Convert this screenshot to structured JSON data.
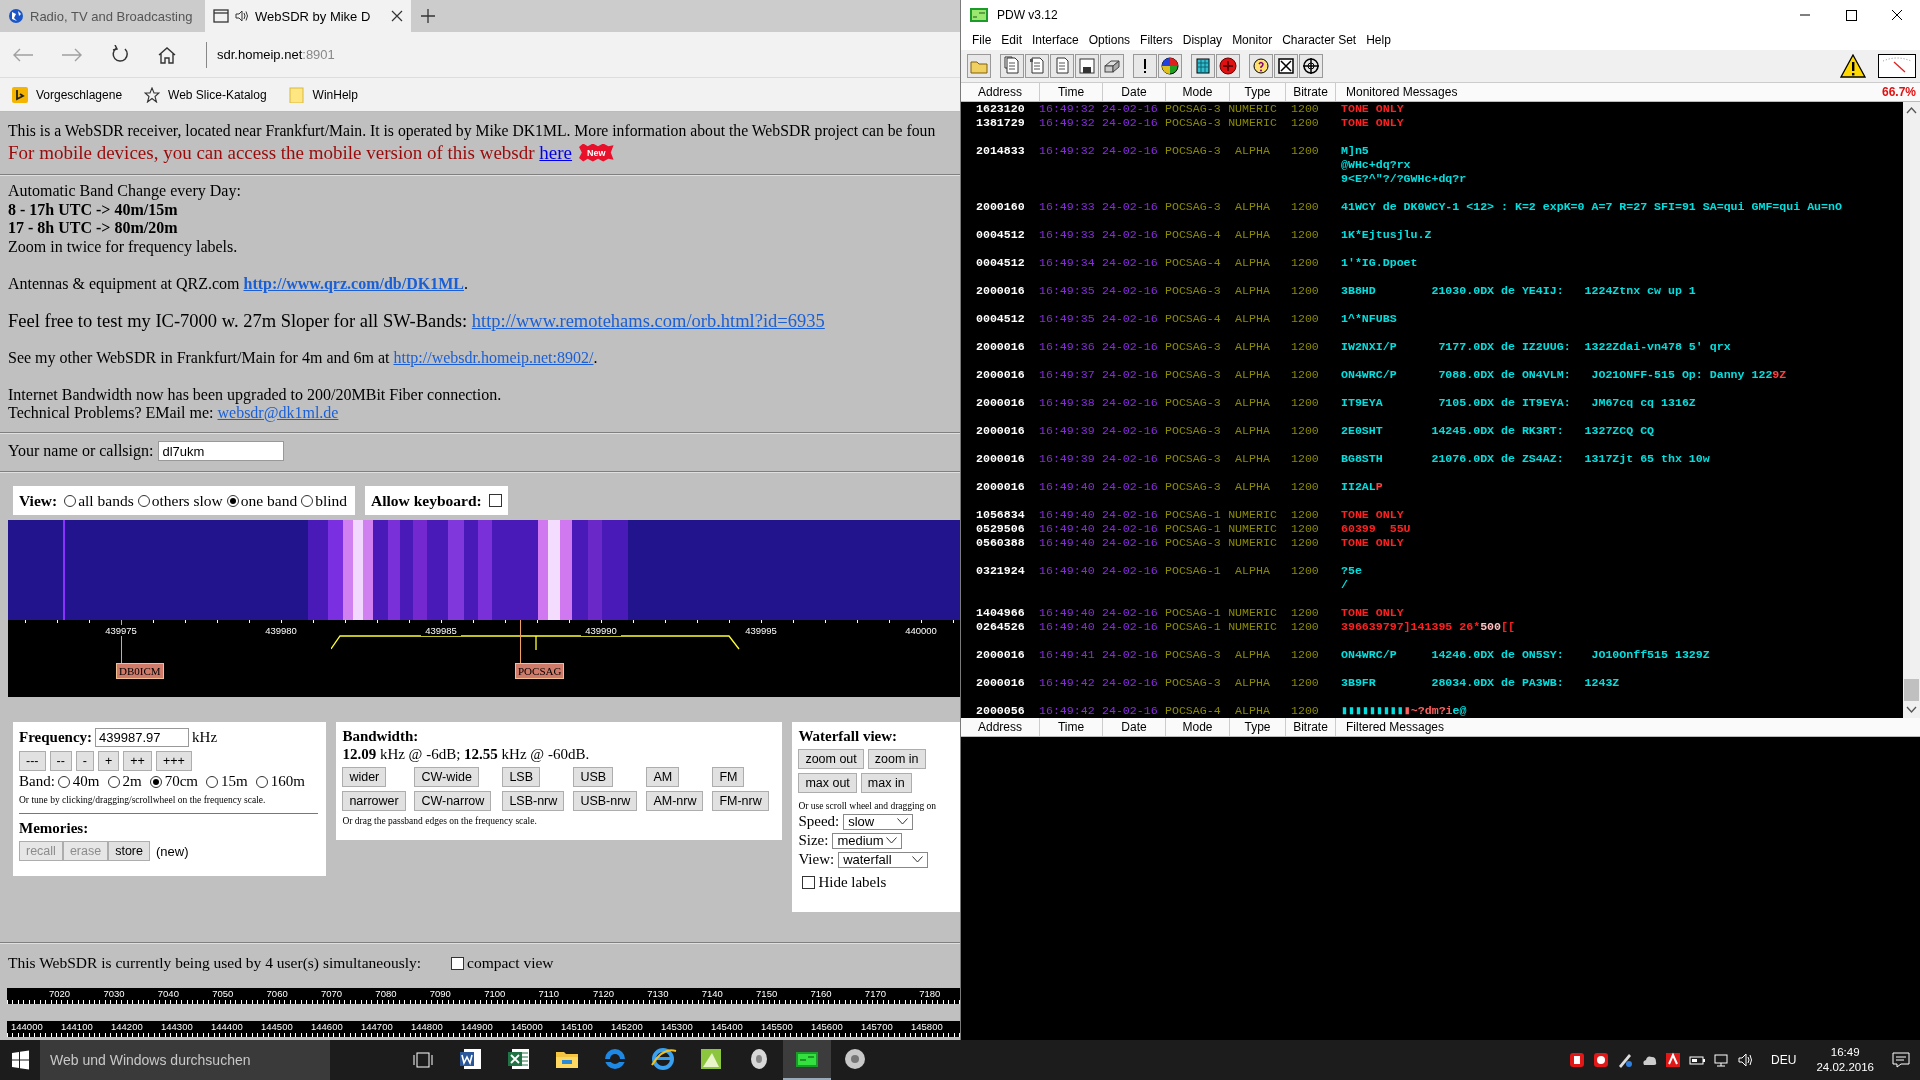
{
  "browser": {
    "tabs": [
      {
        "title": "Radio, TV and Broadcasting",
        "selected": false,
        "kind": "site"
      },
      {
        "title": "WebSDR by Mike D",
        "selected": true,
        "kind": "audio"
      }
    ],
    "address": {
      "host": "sdr.homeip.net",
      "port": ":8901"
    },
    "favorites": [
      {
        "label": "Vorgeschlagene",
        "kind": "logo"
      },
      {
        "label": "Web Slice-Katalog",
        "kind": "star"
      },
      {
        "label": "WinHelp",
        "kind": "folder"
      }
    ]
  },
  "page": {
    "intro": "This is a WebSDR receiver, located near Frankfurt/Main. It is operated by Mike DK1ML. More information about the WebSDR project can be foun",
    "mobile": {
      "text": "For mobile devices, you can access the mobile version of this websdr ",
      "link": "here",
      "badge": "New"
    },
    "schedule": [
      {
        "text": "Automatic Band Change every Day:",
        "bold": false
      },
      {
        "text": "8 - 17h UTC -> 40m/15m",
        "bold": true
      },
      {
        "text": "17 - 8h UTC -> 80m/20m",
        "bold": true
      },
      {
        "text": "Zoom in twice for frequency labels.",
        "bold": false
      }
    ],
    "paragraphs": [
      {
        "kind": "normal",
        "lines": [
          {
            "text": "Antennas & equipment at QRZ.com ",
            "link": "http://www.qrz.com/db/DK1ML",
            "link_bold": true,
            "tail": "."
          }
        ]
      },
      {
        "kind": "large",
        "lines": [
          {
            "text": "Feel free to test my IC-7000 w. 27m Sloper for all SW-Bands: ",
            "link": "http://www.remotehams.com/orb.html?id=6935",
            "link_bold": false
          }
        ]
      },
      {
        "kind": "normal",
        "lines": [
          {
            "text": "See my other WebSDR in Frankfurt/Main for 4m and 6m at ",
            "link": "http://websdr.homeip.net:8902/",
            "link_bold": false,
            "tail": "."
          }
        ]
      },
      {
        "kind": "normal",
        "lines": [
          {
            "text": "Internet Bandwidth now has been upgraded to 200/20MBit Fiber connection."
          },
          {
            "text": "Technical Problems? EMail me: ",
            "link": "websdr@dk1ml.de",
            "link_bold": false
          }
        ]
      }
    ],
    "callsign": {
      "label": "Your name or callsign:",
      "value": "dl7ukm"
    },
    "view": {
      "label": "View:",
      "options": [
        {
          "label": "all bands",
          "selected": false
        },
        {
          "label": "others slow",
          "selected": false
        },
        {
          "label": "one band",
          "selected": true
        },
        {
          "label": "blind",
          "selected": false
        }
      ],
      "keyboard": {
        "label": "Allow keyboard:",
        "checked": false
      }
    },
    "waterfall": {
      "kind": "picture",
      "scale": [
        "439975",
        "439980",
        "439985",
        "439990",
        "439995",
        "440000"
      ],
      "stations": [
        "DB0ICM",
        "POCSAG"
      ]
    },
    "frequency": {
      "label": "Frequency:",
      "value": "439987.97",
      "unit": "kHz",
      "steps": [
        "---",
        "--",
        "-",
        "+",
        "++",
        "+++"
      ],
      "band_label": "Band:",
      "bands": [
        {
          "label": "40m",
          "selected": false
        },
        {
          "label": "2m",
          "selected": false
        },
        {
          "label": "70cm",
          "selected": true
        },
        {
          "label": "15m",
          "selected": false
        },
        {
          "label": "160m",
          "selected": false
        }
      ],
      "hint": "Or tune by clicking/dragging/scrollwheel on the frequency scale.",
      "memories": {
        "title": "Memories:",
        "buttons": [
          {
            "label": "recall",
            "disabled": true
          },
          {
            "label": "erase",
            "disabled": true
          },
          {
            "label": "store",
            "disabled": false
          }
        ],
        "note": "(new)"
      }
    },
    "bandwidth": {
      "title": "Bandwidth:",
      "reading": "**12.09** kHz @ -6dB; **12.55** kHz @ -60dB.",
      "buttons": [
        [
          "wider",
          "CW-wide",
          "LSB",
          "USB",
          "AM",
          "FM"
        ],
        [
          "narrower",
          "CW-narrow",
          "LSB-nrw",
          "USB-nrw",
          "AM-nrw",
          "FM-nrw"
        ]
      ],
      "hint": "Or drag the passband edges on the frequency scale."
    },
    "waterfall_view": {
      "title": "Waterfall view:",
      "buttons": [
        [
          "zoom out",
          "zoom in"
        ],
        [
          "max out",
          "max in"
        ]
      ],
      "hint": "Or use scroll wheel and dragging on",
      "selects": [
        {
          "label": "Speed:",
          "value": "slow"
        },
        {
          "label": "Size:",
          "value": "medium"
        },
        {
          "label": "View:",
          "value": "waterfall"
        }
      ],
      "hide_labels": {
        "label": "Hide labels",
        "checked": false
      }
    },
    "users": {
      "text": "This WebSDR is currently being used by 4 user(s) simultaneously:",
      "compact": {
        "label": "compact view",
        "checked": false
      }
    },
    "band_scales": [
      {
        "labels": [
          "7020",
          "7030",
          "7040",
          "7050",
          "7060",
          "7070",
          "7080",
          "7090",
          "7100",
          "7110",
          "7120",
          "7130",
          "7140",
          "7150",
          "7160",
          "7170",
          "7180"
        ]
      },
      {
        "labels": [
          "144000",
          "144100",
          "144200",
          "144300",
          "144400",
          "144500",
          "144600",
          "144700",
          "144800",
          "144900",
          "145000",
          "145100",
          "145200",
          "145300",
          "145400",
          "145500",
          "145600",
          "145700",
          "145800"
        ]
      }
    ]
  },
  "pdw": {
    "title": "PDW v3.12",
    "menu": [
      "File",
      "Edit",
      "Interface",
      "Options",
      "Filters",
      "Display",
      "Monitor",
      "Character Set",
      "Help"
    ],
    "columns": [
      "Address",
      "Time",
      "Date",
      "Mode",
      "Type",
      "Bitrate"
    ],
    "filtered_columns": [
      "Address",
      "Time",
      "Date",
      "Mode",
      "Type",
      "Bitrate"
    ],
    "monitored_title": "Monitored Messages",
    "load": "66.7%",
    "filtered_title": "Filtered Messages",
    "groups": [
      {
        "messages": [
          {
            "address": "1623120",
            "time": "16:49:32",
            "date": "24-02-16",
            "mode": "POCSAG-3",
            "type": "NUMERIC",
            "bitrate": "1200",
            "lines": [
              [
                {
                  "text": "TONE ONLY",
                  "color": "#ff2020"
                }
              ]
            ]
          },
          {
            "address": "1381729",
            "time": "16:49:32",
            "date": "24-02-16",
            "mode": "POCSAG-3",
            "type": "NUMERIC",
            "bitrate": "1200",
            "lines": [
              [
                {
                  "text": "TONE ONLY",
                  "color": "#ff2020"
                }
              ]
            ]
          }
        ]
      },
      {
        "messages": [
          {
            "address": "2014833",
            "time": "16:49:32",
            "date": "24-02-16",
            "mode": "POCSAG-3",
            "type": "ALPHA",
            "bitrate": "1200",
            "lines": [
              [
                {
                  "text": "M]n5",
                  "color": "#00e0e0"
                }
              ],
              [
                {
                  "text": "@WHc+dq?rx",
                  "color": "#00e0e0"
                }
              ],
              [
                {
                  "text": "9<E?^\"?/?GWHc+dq?r",
                  "color": "#00e0e0"
                }
              ]
            ]
          }
        ]
      },
      {
        "messages": [
          {
            "address": "2000160",
            "time": "16:49:33",
            "date": "24-02-16",
            "mode": "POCSAG-3",
            "type": "ALPHA",
            "bitrate": "1200",
            "lines": [
              [
                {
                  "text": "41WCY de DK0WCY-1 <12> : K=2 expK=0 A=7 R=27 SFI=91 SA=qui GMF=qui Au=nO",
                  "color": "#00e0e0"
                }
              ]
            ]
          }
        ]
      },
      {
        "messages": [
          {
            "address": "0004512",
            "time": "16:49:33",
            "date": "24-02-16",
            "mode": "POCSAG-4",
            "type": "ALPHA",
            "bitrate": "1200",
            "lines": [
              [
                {
                  "text": "1K*Ejtusjlu.Z",
                  "color": "#00e0e0"
                }
              ]
            ]
          }
        ]
      },
      {
        "messages": [
          {
            "address": "0004512",
            "time": "16:49:34",
            "date": "24-02-16",
            "mode": "POCSAG-4",
            "type": "ALPHA",
            "bitrate": "1200",
            "lines": [
              [
                {
                  "text": "1'*IG.Dpoet",
                  "color": "#00e0e0"
                }
              ]
            ]
          }
        ]
      },
      {
        "messages": [
          {
            "address": "2000016",
            "time": "16:49:35",
            "date": "24-02-16",
            "mode": "POCSAG-3",
            "type": "ALPHA",
            "bitrate": "1200",
            "lines": [
              [
                {
                  "text": "3B8HD        21030.0DX de YE4IJ:   1224Ztnx cw up 1",
                  "color": "#00e0e0"
                }
              ]
            ]
          }
        ]
      },
      {
        "messages": [
          {
            "address": "0004512",
            "time": "16:49:35",
            "date": "24-02-16",
            "mode": "POCSAG-4",
            "type": "ALPHA",
            "bitrate": "1200",
            "lines": [
              [
                {
                  "text": "1^*NFUBS",
                  "color": "#00e0e0"
                }
              ]
            ]
          }
        ]
      },
      {
        "messages": [
          {
            "address": "2000016",
            "time": "16:49:36",
            "date": "24-02-16",
            "mode": "POCSAG-3",
            "type": "ALPHA",
            "bitrate": "1200",
            "lines": [
              [
                {
                  "text": "IW2NXI/P      7177.0DX de IZ2UUG:  1322Zdai-vn478 5' qrx",
                  "color": "#00e0e0"
                }
              ]
            ]
          }
        ]
      },
      {
        "messages": [
          {
            "address": "2000016",
            "time": "16:49:37",
            "date": "24-02-16",
            "mode": "POCSAG-3",
            "type": "ALPHA",
            "bitrate": "1200",
            "lines": [
              [
                {
                  "text": "ON4WRC/P      7088.0DX de ON4VLM:   JO21ONFF-515 Op: Danny 122",
                  "color": "#00e0e0"
                },
                {
                  "text": "9Z",
                  "color": "#ff4040"
                }
              ]
            ]
          }
        ]
      },
      {
        "messages": [
          {
            "address": "2000016",
            "time": "16:49:38",
            "date": "24-02-16",
            "mode": "POCSAG-3",
            "type": "ALPHA",
            "bitrate": "1200",
            "lines": [
              [
                {
                  "text": "IT9EYA        7105.0DX de IT9EYA:   JM67cq cq 1316Z",
                  "color": "#00e0e0"
                }
              ]
            ]
          }
        ]
      },
      {
        "messages": [
          {
            "address": "2000016",
            "time": "16:49:39",
            "date": "24-02-16",
            "mode": "POCSAG-3",
            "type": "ALPHA",
            "bitrate": "1200",
            "lines": [
              [
                {
                  "text": "2E0SHT       14245.0DX de RK3RT:   1327ZCQ CQ",
                  "color": "#00e0e0"
                }
              ]
            ]
          }
        ]
      },
      {
        "messages": [
          {
            "address": "2000016",
            "time": "16:49:39",
            "date": "24-02-16",
            "mode": "POCSAG-3",
            "type": "ALPHA",
            "bitrate": "1200",
            "lines": [
              [
                {
                  "text": "BG8STH       21076.0DX de ZS4AZ:   1317Zjt 65 thx 10w",
                  "color": "#00e0e0"
                }
              ]
            ]
          }
        ]
      },
      {
        "messages": [
          {
            "address": "2000016",
            "time": "16:49:40",
            "date": "24-02-16",
            "mode": "POCSAG-3",
            "type": "ALPHA",
            "bitrate": "1200",
            "lines": [
              [
                {
                  "text": "II2AL",
                  "color": "#00e0e0"
                },
                {
                  "text": "P",
                  "color": "#ff4040"
                }
              ]
            ]
          }
        ]
      },
      {
        "messages": [
          {
            "address": "1056834",
            "time": "16:49:40",
            "date": "24-02-16",
            "mode": "POCSAG-1",
            "type": "NUMERIC",
            "bitrate": "1200",
            "lines": [
              [
                {
                  "text": "TONE ONLY",
                  "color": "#ff2020"
                }
              ]
            ]
          },
          {
            "address": "0529506",
            "time": "16:49:40",
            "date": "24-02-16",
            "mode": "POCSAG-1",
            "type": "NUMERIC",
            "bitrate": "1200",
            "lines": [
              [
                {
                  "text": "60399  55U",
                  "color": "#ff2020"
                }
              ]
            ]
          },
          {
            "address": "0560388",
            "time": "16:49:40",
            "date": "24-02-16",
            "mode": "POCSAG-3",
            "type": "NUMERIC",
            "bitrate": "1200",
            "lines": [
              [
                {
                  "text": "TONE ONLY",
                  "color": "#ff2020"
                }
              ]
            ]
          }
        ]
      },
      {
        "messages": [
          {
            "address": "0321924",
            "time": "16:49:40",
            "date": "24-02-16",
            "mode": "POCSAG-1",
            "type": "ALPHA",
            "bitrate": "1200",
            "lines": [
              [
                {
                  "text": "?5e",
                  "color": "#00e0e0"
                }
              ],
              [
                {
                  "text": "/",
                  "color": "#00e0e0"
                }
              ]
            ]
          }
        ]
      },
      {
        "messages": [
          {
            "address": "1404966",
            "time": "16:49:40",
            "date": "24-02-16",
            "mode": "POCSAG-1",
            "type": "NUMERIC",
            "bitrate": "1200",
            "lines": [
              [
                {
                  "text": "TONE ONLY",
                  "color": "#ff2020"
                }
              ]
            ]
          },
          {
            "address": "0264526",
            "time": "16:49:40",
            "date": "24-02-16",
            "mode": "POCSAG-1",
            "type": "NUMERIC",
            "bitrate": "1200",
            "lines": [
              [
                {
                  "text": "396639797]141395 26*",
                  "color": "#ff2020"
                },
                {
                  "text": "500",
                  "color": "#ffc0c0"
                },
                {
                  "text": "[[",
                  "color": "#ff2020"
                }
              ]
            ]
          }
        ]
      },
      {
        "messages": [
          {
            "address": "2000016",
            "time": "16:49:41",
            "date": "24-02-16",
            "mode": "POCSAG-3",
            "type": "ALPHA",
            "bitrate": "1200",
            "lines": [
              [
                {
                  "text": "ON4WRC/P     14246.0DX de ON5SY:    JO10Onff515 1329Z",
                  "color": "#00e0e0"
                }
              ]
            ]
          }
        ]
      },
      {
        "messages": [
          {
            "address": "2000016",
            "time": "16:49:42",
            "date": "24-02-16",
            "mode": "POCSAG-3",
            "type": "ALPHA",
            "bitrate": "1200",
            "lines": [
              [
                {
                  "text": "3B9FR        28034.0DX de PA3WB:   1243Z",
                  "color": "#00e0e0"
                }
              ]
            ]
          }
        ]
      },
      {
        "messages": [
          {
            "address": "2000056",
            "time": "16:49:42",
            "date": "24-02-16",
            "mode": "POCSAG-4",
            "type": "ALPHA",
            "bitrate": "1200",
            "lines": [
              [
                {
                  "text": "▮▮▮▮▮▮▮▮▮",
                  "color": "#00e0e0"
                },
                {
                  "text": "▮~?dm?i",
                  "color": "#ff6060"
                },
                {
                  "text": "e@",
                  "color": "#00e0e0"
                }
              ]
            ]
          }
        ]
      }
    ]
  },
  "taskbar": {
    "search": {
      "placeholder": "Web und Windows durchsuchen"
    },
    "apps": [
      {
        "selected": false
      },
      {
        "selected": false
      },
      {
        "selected": false
      },
      {
        "selected": false
      },
      {
        "selected": false
      },
      {
        "selected": false
      },
      {
        "selected": false
      },
      {
        "selected": true
      },
      {
        "selected": false
      }
    ],
    "language": "DEU",
    "time": "16:49",
    "date": "24.02.2016"
  }
}
